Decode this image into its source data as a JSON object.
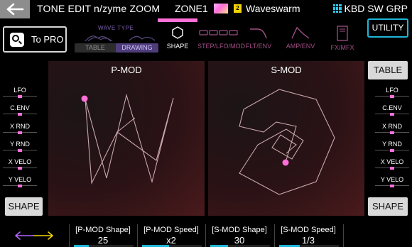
{
  "header": {
    "title": "TONE EDIT n/zyme ZOOM",
    "zone": "ZONE1",
    "zone_badge": "2",
    "wave_name": "Waveswarm",
    "kbd": "KBD SW GRP"
  },
  "to_pro": {
    "label": "To PRO"
  },
  "wave_type": {
    "label": "WAVE TYPE",
    "options": [
      "TABLE",
      "DRAWING"
    ],
    "selected": "DRAWING"
  },
  "edit_tabs": [
    {
      "label": "SHAPE",
      "active": true
    },
    {
      "label": "STEP/LFO/MOD",
      "active": false
    },
    {
      "label": "FLT/ENV",
      "active": false
    },
    {
      "label": "AMP/ENV",
      "active": false
    },
    {
      "label": "FX/MFX",
      "active": false
    }
  ],
  "utility": {
    "label": "UTILITY"
  },
  "left_column": {
    "items": [
      "LFO",
      "C.ENV",
      "X RND",
      "Y RND",
      "X VELO",
      "Y VELO"
    ],
    "shape_button": "SHAPE"
  },
  "right_column": {
    "table_button": "TABLE",
    "items": [
      "LFO",
      "C.ENV",
      "X RND",
      "Y RND",
      "X VELO",
      "Y VELO"
    ],
    "shape_button": "SHAPE"
  },
  "panels": {
    "p_mod": {
      "title": "P-MOD"
    },
    "s_mod": {
      "title": "S-MOD"
    }
  },
  "params": [
    {
      "name": "[P-MOD Shape]",
      "value": "25",
      "level": 0.25
    },
    {
      "name": "[P-MOD Speed]",
      "value": "x2",
      "level": 0.45
    },
    {
      "name": "[S-MOD Shape]",
      "value": "30",
      "level": 0.3
    },
    {
      "name": "[S-MOD Speed]",
      "value": "1/3",
      "level": 0.35
    }
  ],
  "colors": {
    "accent_pink": "#ff6fd8",
    "accent_cyan": "#1fb6d8",
    "badge_yellow": "#f2d400",
    "button_gray": "#d9d9d9"
  }
}
